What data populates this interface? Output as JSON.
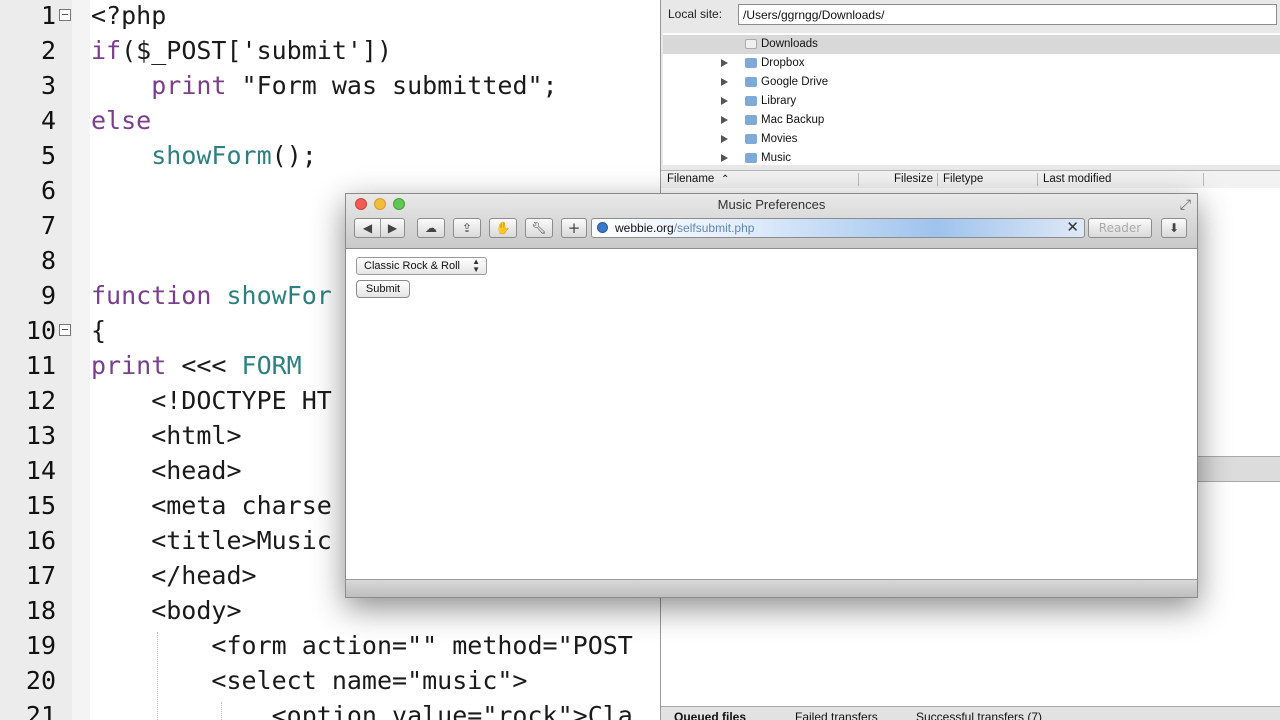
{
  "editor": {
    "lines": [
      {
        "n": "1",
        "tokens": [
          {
            "t": "<?php",
            "c": "plain"
          }
        ],
        "fold": true
      },
      {
        "n": "2",
        "tokens": [
          {
            "t": "if",
            "c": "kw"
          },
          {
            "t": "($_POST['submit'])",
            "c": "plain"
          }
        ]
      },
      {
        "n": "3",
        "tokens": [
          {
            "t": "    ",
            "c": "plain"
          },
          {
            "t": "print",
            "c": "kw"
          },
          {
            "t": " \"Form was submitted\";",
            "c": "plain"
          }
        ]
      },
      {
        "n": "4",
        "tokens": [
          {
            "t": "else",
            "c": "kw"
          }
        ]
      },
      {
        "n": "5",
        "tokens": [
          {
            "t": "    ",
            "c": "plain"
          },
          {
            "t": "showForm",
            "c": "fn"
          },
          {
            "t": "();",
            "c": "plain"
          }
        ]
      },
      {
        "n": "6",
        "tokens": []
      },
      {
        "n": "7",
        "tokens": []
      },
      {
        "n": "8",
        "tokens": []
      },
      {
        "n": "9",
        "tokens": [
          {
            "t": "function",
            "c": "kw"
          },
          {
            "t": " ",
            "c": "plain"
          },
          {
            "t": "showFor",
            "c": "fn"
          }
        ]
      },
      {
        "n": "10",
        "tokens": [
          {
            "t": "{",
            "c": "plain"
          }
        ],
        "fold": true
      },
      {
        "n": "11",
        "tokens": [
          {
            "t": "print",
            "c": "kw"
          },
          {
            "t": " <<< ",
            "c": "plain"
          },
          {
            "t": "FORM",
            "c": "fn"
          }
        ]
      },
      {
        "n": "12",
        "tokens": [
          {
            "t": "    <!DOCTYPE HT",
            "c": "plain"
          }
        ]
      },
      {
        "n": "13",
        "tokens": [
          {
            "t": "    <html>",
            "c": "plain"
          }
        ]
      },
      {
        "n": "14",
        "tokens": [
          {
            "t": "    <head>",
            "c": "plain"
          }
        ]
      },
      {
        "n": "15",
        "tokens": [
          {
            "t": "    <meta charse",
            "c": "plain"
          }
        ]
      },
      {
        "n": "16",
        "tokens": [
          {
            "t": "    <title>Music",
            "c": "plain"
          }
        ]
      },
      {
        "n": "17",
        "tokens": [
          {
            "t": "    </head>",
            "c": "plain"
          }
        ]
      },
      {
        "n": "18",
        "tokens": [
          {
            "t": "    <body>",
            "c": "plain"
          }
        ]
      },
      {
        "n": "19",
        "tokens": [
          {
            "t": "        <form action=\"\" method=\"POST",
            "c": "plain"
          }
        ]
      },
      {
        "n": "20",
        "tokens": [
          {
            "t": "        <select name=\"music\">",
            "c": "plain"
          }
        ]
      },
      {
        "n": "21",
        "tokens": [
          {
            "t": "            <option value=\"rock\">Cla",
            "c": "plain"
          }
        ]
      }
    ]
  },
  "ftp": {
    "local_site_label": "Local site:",
    "local_site_path": "/Users/ggrngg/Downloads/",
    "tree": [
      {
        "label": "Downloads",
        "expandable": false,
        "selected": true
      },
      {
        "label": "Dropbox",
        "expandable": true
      },
      {
        "label": "Google Drive",
        "expandable": true
      },
      {
        "label": "Library",
        "expandable": true
      },
      {
        "label": "Mac Backup",
        "expandable": true
      },
      {
        "label": "Movies",
        "expandable": true
      },
      {
        "label": "Music",
        "expandable": true
      }
    ],
    "columns": {
      "filename": "Filename",
      "filesize": "Filesize",
      "filetype": "Filetype",
      "last_modified": "Last modified"
    },
    "tabs": {
      "queued": "Queued files",
      "failed": "Failed transfers",
      "successful": "Successful transfers (7)"
    }
  },
  "browser": {
    "title": "Music Preferences",
    "url_host": "webbie.org",
    "url_path": "/selfsubmit.php",
    "reader_label": "Reader",
    "select_value": "Classic Rock & Roll",
    "submit_label": "Submit"
  }
}
